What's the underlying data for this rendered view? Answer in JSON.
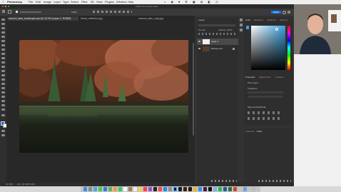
{
  "menubar": {
    "items": [
      "Photoshop",
      "File",
      "Edit",
      "Image",
      "Layer",
      "Type",
      "Select",
      "Filter",
      "3D",
      "View",
      "Plugins",
      "Window",
      "Help"
    ]
  },
  "window": {
    "title": "Adobe Photoshop 2024"
  },
  "options": {
    "zoom": "100%"
  },
  "document_tabs": [
    {
      "label": "autumn_lake_landscape.psd @ 33.3% (Layer 1, RGB/8)",
      "active": true
    },
    {
      "label": "forest_reflection.jpg",
      "active": false
    },
    {
      "label": "autumn_lake_copy.jpg",
      "active": false
    }
  ],
  "status": {
    "zoom": "33.33%",
    "doc_size": "Doc: 36.6M/73.2M"
  },
  "layers_panel": {
    "title": "Layers",
    "mode": "Normal",
    "opacity_label": "Opacity: 100%",
    "layers": [
      {
        "name": "Layer 1",
        "selected": true
      },
      {
        "name": "Background",
        "selected": false
      }
    ]
  },
  "color_panel": {
    "tabs": [
      "Color",
      "Swatches",
      "Gradients",
      "Patterns"
    ],
    "accent": "#39a0dc"
  },
  "properties_panel": {
    "tabs": [
      "Properties",
      "Adjustments",
      "Libraries"
    ],
    "heading": "Pixel Layer",
    "section_transform": "Transform",
    "section_align": "Align and Distribute"
  },
  "history_panel": {
    "tabs": [
      "Channels",
      "Paths"
    ]
  },
  "share_button": "Share",
  "colors": {
    "accent_blue": "#1473e6"
  }
}
